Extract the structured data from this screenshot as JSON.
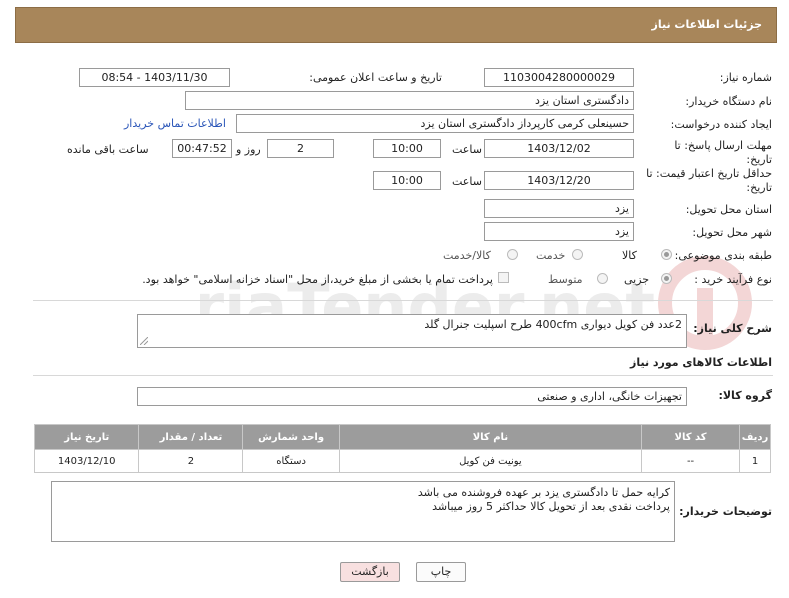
{
  "header": {
    "title": "جزئیات اطلاعات نیاز"
  },
  "form": {
    "need_number": {
      "label": "شماره نیاز:",
      "value": "1103004280000029"
    },
    "announce": {
      "label": "تاریخ و ساعت اعلان عمومی:",
      "value": "1403/11/30 - 08:54"
    },
    "buyer_org": {
      "label": "نام دستگاه خریدار:",
      "value": "دادگستری استان یزد"
    },
    "creator": {
      "label": "ایجاد کننده درخواست:",
      "value": "حسینعلی کرمی کارپرداز دادگستری استان یزد",
      "contact_link": "اطلاعات تماس خریدار"
    },
    "deadline": {
      "label_line1": "مهلت ارسال پاسخ: تا",
      "label_line2": "تاریخ:",
      "date": "1403/12/02",
      "time_label": "ساعت",
      "time": "10:00",
      "days": "2",
      "days_label": "روز و",
      "remaining": "00:47:52",
      "remaining_label": "ساعت باقی مانده"
    },
    "validity": {
      "label_line1": "حداقل تاریخ اعتبار قیمت: تا",
      "label_line2": "تاریخ:",
      "date": "1403/12/20",
      "time_label": "ساعت",
      "time": "10:00"
    },
    "province": {
      "label": "استان محل تحویل:",
      "value": "یزد"
    },
    "city": {
      "label": "شهر محل تحویل:",
      "value": "یزد"
    },
    "category": {
      "label": "طبقه بندی موضوعی:",
      "options": [
        "کالا",
        "خدمت",
        "کالا/خدمت"
      ],
      "selected": "کالا"
    },
    "process": {
      "label": "نوع فرآیند خرید :",
      "options": [
        "جزیی",
        "متوسط"
      ],
      "selected": "جزیی",
      "payment_text": "پرداخت تمام یا بخشی از مبلغ خرید،از محل \"اسناد خزانه اسلامی\" خواهد بود."
    },
    "description": {
      "label": "شرح کلی نیاز:",
      "value": "2عدد فن کویل دیواری 400cfm طرح اسپلیت جنرال گلد"
    }
  },
  "goods": {
    "section_title": "اطلاعات کالاهای مورد نیاز",
    "group_label": "گروه کالا:",
    "group_value": "تجهیزات خانگی، اداری و صنعتی",
    "table": {
      "headers": [
        "ردیف",
        "کد کالا",
        "نام کالا",
        "واحد شمارش",
        "تعداد / مقدار",
        "تاریخ نیاز"
      ],
      "rows": [
        [
          "1",
          "--",
          "یونیت فن کویل",
          "دستگاه",
          "2",
          "1403/12/10"
        ]
      ]
    }
  },
  "buyer_notes": {
    "label": "توضیحات خریدار:",
    "line1": "کرایه حمل تا دادگستری یزد بر عهده فروشنده می باشد",
    "line2": "پرداخت نقدی بعد از تحویل کالا حداکثر 5 روز میباشد"
  },
  "buttons": {
    "print": "چاپ",
    "back": "بازگشت"
  },
  "watermark": {
    "text": "AriaTender.net"
  },
  "colors": {
    "header_bg": "#a8865a",
    "table_header_bg": "#9c9c9c",
    "link": "#2a55b8",
    "back_button_bg": "#f8e0e0"
  }
}
